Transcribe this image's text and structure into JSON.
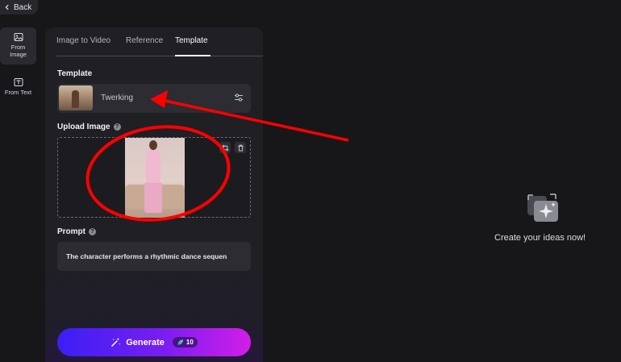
{
  "back": {
    "label": "Back"
  },
  "rail": [
    {
      "label": "From\nImage",
      "icon": "image-icon",
      "active": true
    },
    {
      "label": "From Text",
      "icon": "text-image-icon",
      "active": false
    }
  ],
  "tabs": [
    {
      "label": "Image to Video",
      "active": false
    },
    {
      "label": "Reference",
      "active": false
    },
    {
      "label": "Template",
      "active": true
    }
  ],
  "template": {
    "section_label": "Template",
    "selected_name": "Twerking",
    "settings_icon": "sliders-icon"
  },
  "upload": {
    "section_label": "Upload Image",
    "help_icon": "question-icon",
    "actions": [
      "crop-icon",
      "trash-icon"
    ]
  },
  "prompt": {
    "section_label": "Prompt",
    "value": "The character performs a rhythmic dance sequen"
  },
  "generate": {
    "label": "Generate",
    "credits": "10",
    "gradient": [
      "#3a1ff5",
      "#7a1ef0",
      "#d21ee8"
    ]
  },
  "empty_state": {
    "text": "Create your ideas now!",
    "icon": "sparkle-media-icon"
  },
  "annotation": {
    "color": "#ff0000"
  }
}
